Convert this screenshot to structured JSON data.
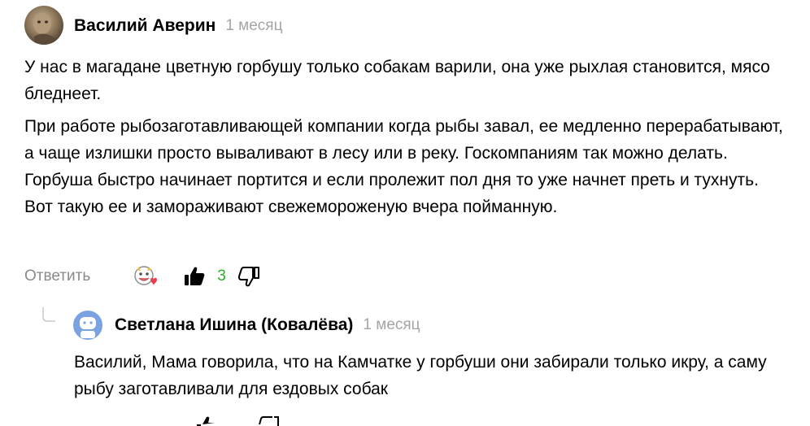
{
  "comment": {
    "author": "Василий Аверин",
    "time": "1 месяц",
    "paragraphs": [
      "У нас в магадане цветную горбушу только собакам варили, она уже рыхлая становится, мясо бледнеет.",
      "При работе рыбозаготавливающей компании когда рыбы завал, ее медленно перерабатывают, а чаще излишки просто вываливают в лесу или в реку. Госкомпаниям так можно делать. Горбуша быстро начинает портится и если пролежит пол дня то уже начнет преть и тухнуть. Вот такую ее и замораживают свежемороженую вчера пойманную."
    ],
    "actions": {
      "reply_label": "Ответить",
      "like_count": "3"
    }
  },
  "reply": {
    "author": "Светлана Ишина (Ковалёва)",
    "time": "1 месяц",
    "text": "Василий, Мама говорила, что на Камчатке у горбуши они забирали только икру, а саму рыбу заготавливали для ездовых собак"
  },
  "icons": {
    "reaction": "reaction-emoji-icon",
    "like": "thumbs-up-icon",
    "dislike": "thumbs-down-icon",
    "thread": "reply-thread-icon"
  },
  "colors": {
    "like_count": "#22b322",
    "muted_text": "#a5a5a5",
    "reply_link": "#8a8a8a",
    "reply_avatar_bg": "#7aa1e0"
  }
}
